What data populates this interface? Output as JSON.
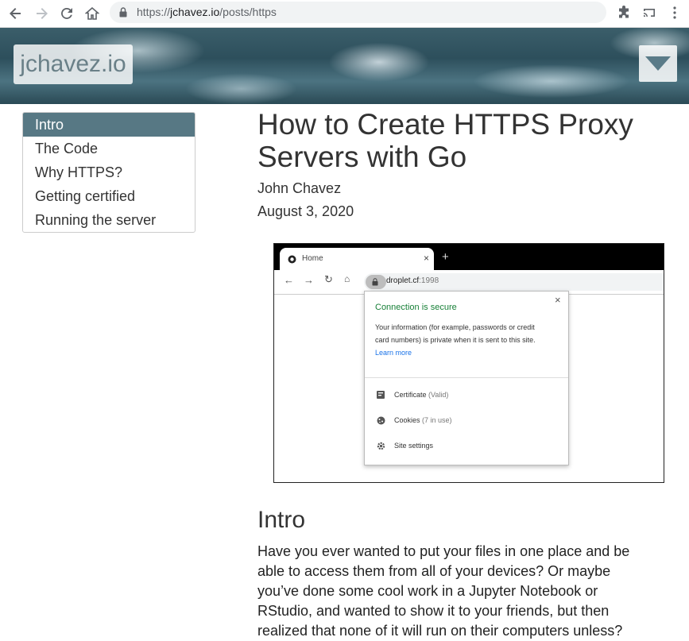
{
  "browser": {
    "url_scheme": "https://",
    "url_host": "jchavez.io",
    "url_path": "/posts/https"
  },
  "site": {
    "logo_text": "jchavez.io"
  },
  "toc": {
    "items": [
      {
        "label": "Intro",
        "active": true
      },
      {
        "label": "The Code",
        "active": false
      },
      {
        "label": "Why HTTPS?",
        "active": false
      },
      {
        "label": "Getting certified",
        "active": false
      },
      {
        "label": "Running the server",
        "active": false
      }
    ]
  },
  "article": {
    "title": "How to Create HTTPS Proxy Servers with Go",
    "author": "John Chavez",
    "date": "August 3, 2020",
    "section_heading": "Intro",
    "paragraph": "Have you ever wanted to put your files in one place and be able to access them from all of your devices? Or maybe you’ve done some cool work in a Jupyter Notebook or RStudio, and wanted to show it to your friends, but then realized that none of it will run on their computers unless?"
  },
  "figure": {
    "tab_title": "Home",
    "url_host": "droplet.cf",
    "url_port": ":1998",
    "popup_title": "Connection is secure",
    "popup_body_line1": "Your information (for example, passwords or credit",
    "popup_body_line2": "card numbers) is private when it is sent to this site.",
    "learn_more": "Learn more",
    "certificate_label": "Certificate",
    "certificate_status": "(Valid)",
    "cookies_label": "Cookies",
    "cookies_status": "(7 in use)",
    "site_settings_label": "Site settings"
  },
  "colors": {
    "toc_active_bg": "#577884",
    "secure_green": "#188038",
    "link_blue": "#1a73e8"
  }
}
